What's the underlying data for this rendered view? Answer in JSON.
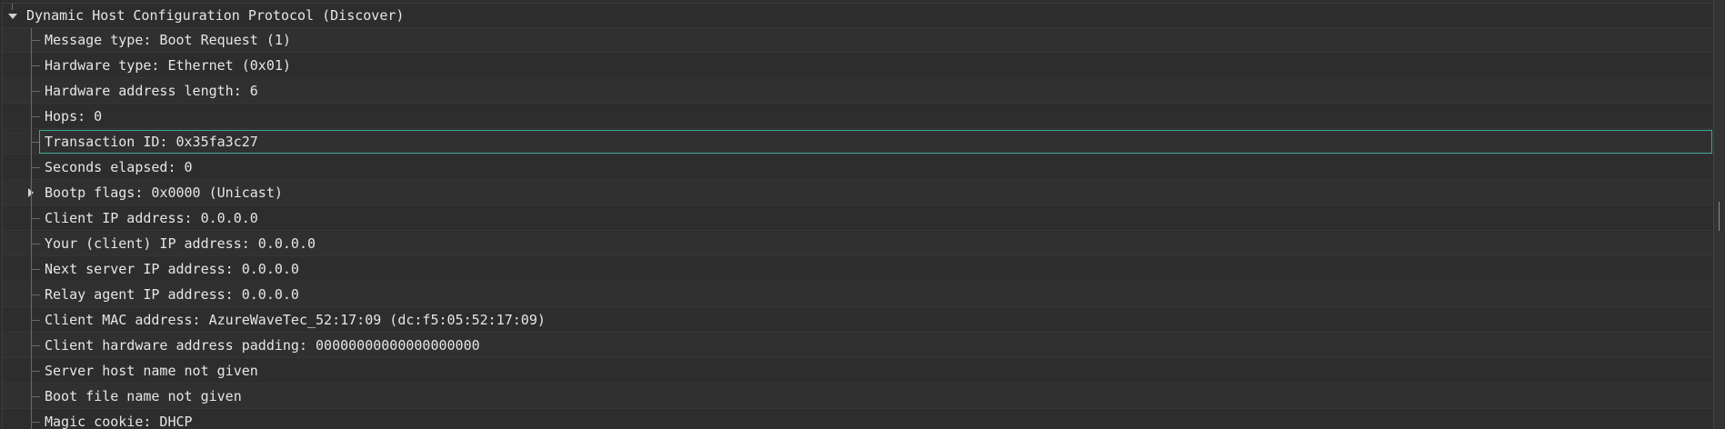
{
  "tree": {
    "root": {
      "label": "Dynamic Host Configuration Protocol (Discover)",
      "expanded": true
    },
    "children": [
      {
        "label": "Message type: Boot Request (1)"
      },
      {
        "label": "Hardware type: Ethernet (0x01)"
      },
      {
        "label": "Hardware address length: 6"
      },
      {
        "label": "Hops: 0"
      },
      {
        "label": "Transaction ID: 0x35fa3c27",
        "selected": true
      },
      {
        "label": "Seconds elapsed: 0"
      },
      {
        "label": "Bootp flags: 0x0000 (Unicast)",
        "expandable": true
      },
      {
        "label": "Client IP address: 0.0.0.0"
      },
      {
        "label": "Your (client) IP address: 0.0.0.0"
      },
      {
        "label": "Next server IP address: 0.0.0.0"
      },
      {
        "label": "Relay agent IP address: 0.0.0.0"
      },
      {
        "label": "Client MAC address: AzureWaveTec_52:17:09 (dc:f5:05:52:17:09)"
      },
      {
        "label": "Client hardware address padding: 00000000000000000000"
      },
      {
        "label": "Server host name not given"
      },
      {
        "label": "Boot file name not given"
      },
      {
        "label": "Magic cookie: DHCP"
      }
    ]
  },
  "colors": {
    "background": "#2d2d2d",
    "text": "#e6e6e6",
    "selection_border": "#3aa896",
    "tree_lines": "#6a6a6a"
  }
}
